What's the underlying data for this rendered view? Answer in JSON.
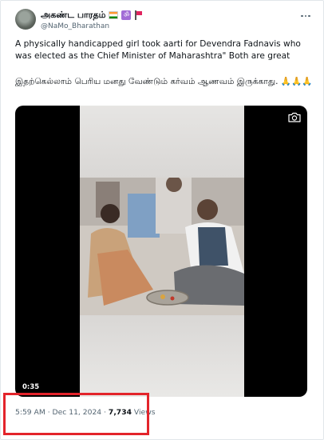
{
  "author": {
    "display_name": "அகண்ட பாரதம்",
    "handle": "@NaMo_Bharathan",
    "om_symbol": "ॐ",
    "badges": [
      "india-flag-icon",
      "om-icon",
      "red-flag-icon"
    ]
  },
  "tweet": {
    "text_en": "A physically handicapped girl took aarti for Devendra Fadnavis who was elected as the Chief Minister of Maharashtra\" Both are great",
    "text_ta": "இதற்கெல்லாம் பெரிய மனது வேண்டும் கர்வம் ஆணவம் இருக்காது. 🙏🙏🙏"
  },
  "video": {
    "duration": "0:35"
  },
  "meta": {
    "time": "5:59 AM",
    "date": "Dec 11, 2024",
    "separator": "·",
    "views_count": "7,734",
    "views_label": "Views"
  },
  "colors": {
    "highlight": "#e3242b",
    "muted_text": "#536471"
  }
}
